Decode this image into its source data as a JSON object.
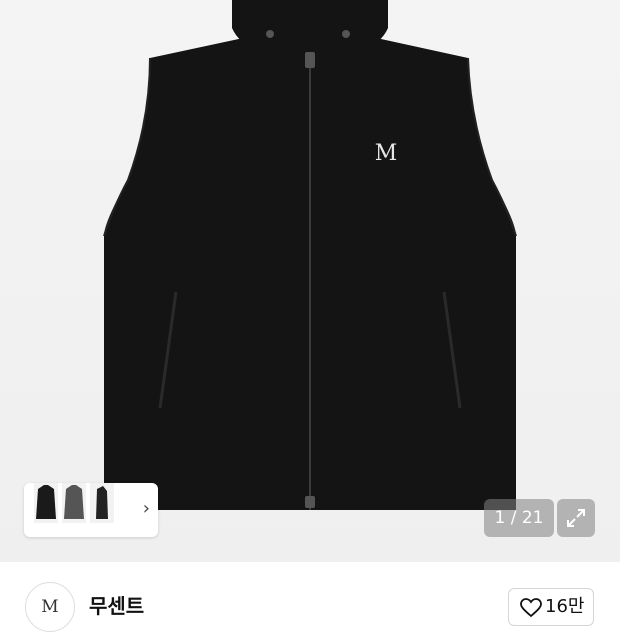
{
  "product": {
    "image_alt": "black zip-up hooded vest",
    "chest_logo": "M",
    "thumbnails": [
      "thumbnail-front-black",
      "thumbnail-charcoal",
      "thumbnail-side"
    ],
    "thumbnail_arrow": "›",
    "image_counter": "1 / 21",
    "expand_icon": "expand-icon"
  },
  "brand": {
    "logo_text": "M",
    "name": "무센트"
  },
  "like": {
    "icon": "heart-icon",
    "count": "16만"
  },
  "colors": {
    "vest": "#141414",
    "background": "#f1f1f1"
  }
}
